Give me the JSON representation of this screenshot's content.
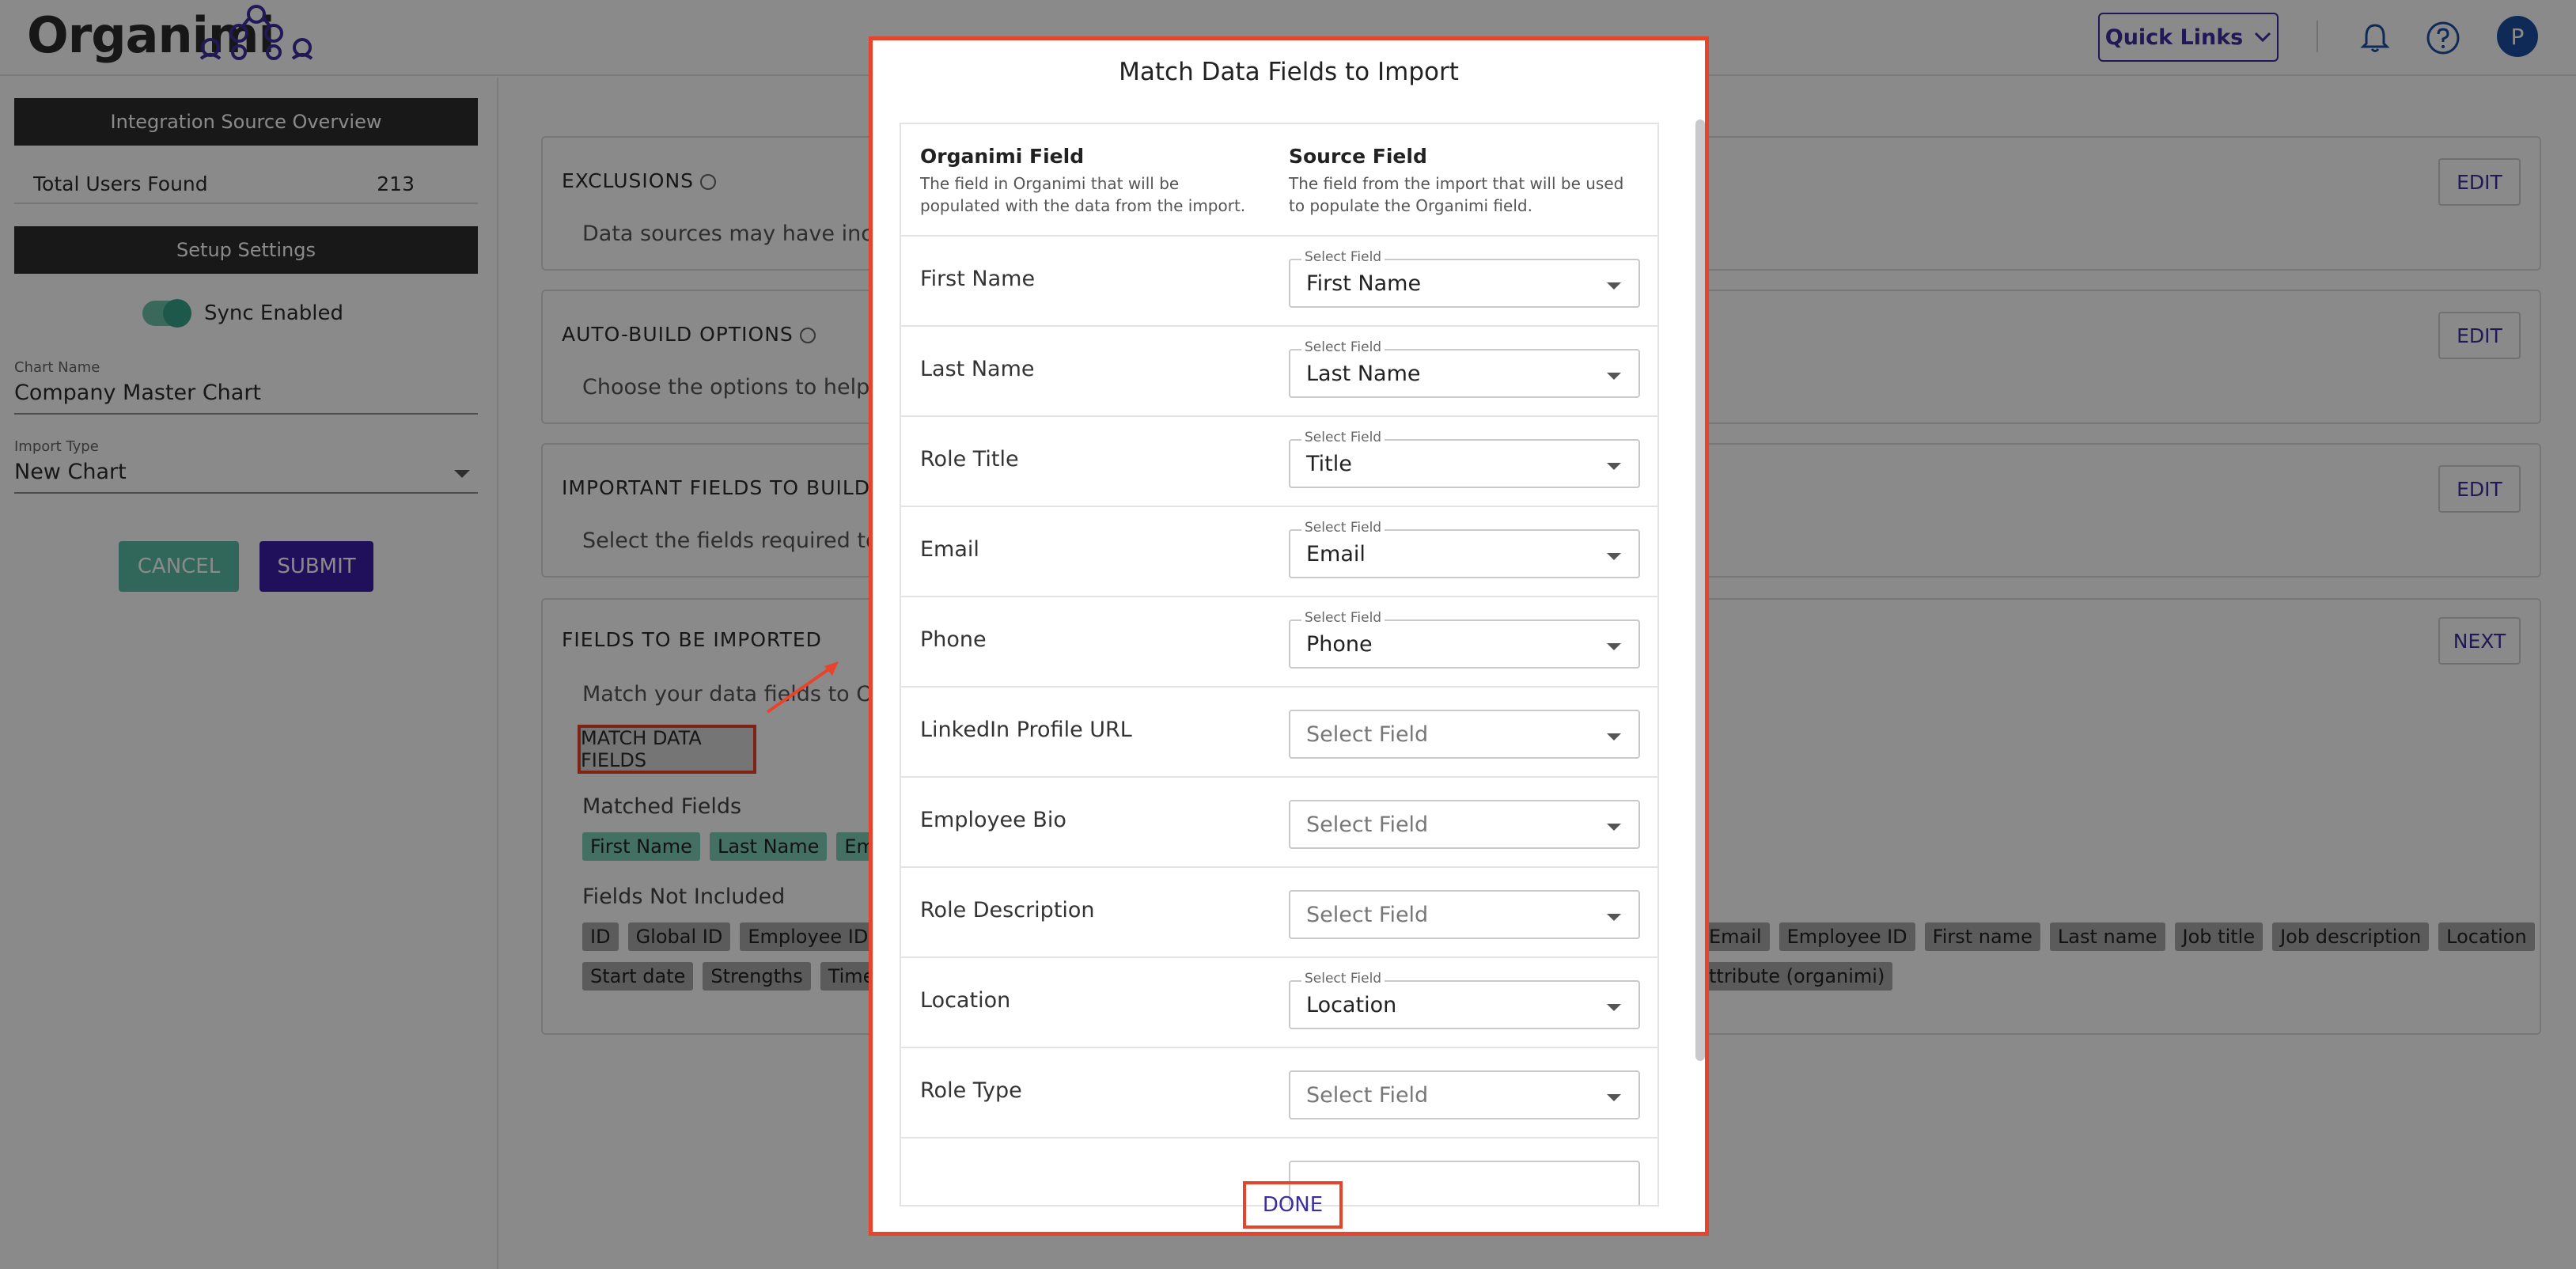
{
  "app": {
    "logo": "Organimi"
  },
  "header": {
    "quick_links": "Quick Links",
    "avatar_initial": "P"
  },
  "left": {
    "overview_title": "Integration Source Overview",
    "total_users_label": "Total Users Found",
    "total_users_value": "213",
    "setup_title": "Setup Settings",
    "sync_label": "Sync Enabled",
    "chart_name_label": "Chart Name",
    "chart_name_value": "Company Master Chart",
    "import_type_label": "Import Type",
    "import_type_value": "New Chart",
    "cancel": "CANCEL",
    "submit": "SUBMIT"
  },
  "cards": {
    "exclusions": {
      "title": "EXCLUSIONS",
      "desc": "Data sources may have incom",
      "btn": "EDIT"
    },
    "auto_build": {
      "title": "AUTO-BUILD OPTIONS",
      "desc": "Choose the options to help cu",
      "btn": "EDIT"
    },
    "important": {
      "title": "IMPORTANT FIELDS TO BUILD CHA",
      "desc": "Select the fields required to bu",
      "btn": "EDIT"
    },
    "fields": {
      "title": "FIELDS TO BE IMPORTED",
      "desc": "Match your data fields to Orga",
      "btn": "NEXT",
      "match_btn": "MATCH DATA FIELDS",
      "matched_label": "Matched Fields",
      "matched": [
        "First Name",
        "Last Name",
        "Ema"
      ],
      "not_included_label": "Fields Not Included",
      "not_included_row1_left": [
        "ID",
        "Global ID",
        "Employee ID"
      ],
      "not_included_row1_right": [
        "Email",
        "Employee ID",
        "First name",
        "Last name",
        "Job title",
        "Job description",
        "Location"
      ],
      "not_included_row2_left": [
        "Start date",
        "Strengths",
        "Timez"
      ],
      "not_included_row2_right": [
        "ttribute (organimi)"
      ]
    }
  },
  "modal": {
    "title": "Match Data Fields to Import",
    "col1_title": "Organimi Field",
    "col1_desc": "The field in Organimi that will be populated with the data from the import.",
    "col2_title": "Source Field",
    "col2_desc": "The field from the import that will be used to populate the Organimi field.",
    "select_label": "Select Field",
    "rows": [
      {
        "field": "First Name",
        "value": "First Name",
        "selected": true
      },
      {
        "field": "Last Name",
        "value": "Last Name",
        "selected": true
      },
      {
        "field": "Role Title",
        "value": "Title",
        "selected": true
      },
      {
        "field": "Email",
        "value": "Email",
        "selected": true
      },
      {
        "field": "Phone",
        "value": "Phone",
        "selected": true
      },
      {
        "field": "LinkedIn Profile URL",
        "value": "Select Field",
        "selected": false
      },
      {
        "field": "Employee Bio",
        "value": "Select Field",
        "selected": false
      },
      {
        "field": "Role Description",
        "value": "Select Field",
        "selected": false
      },
      {
        "field": "Location",
        "value": "Location",
        "selected": true
      },
      {
        "field": "Role Type",
        "value": "Select Field",
        "selected": false
      }
    ],
    "done": "DONE"
  },
  "colors": {
    "accent": "#3b2fa0",
    "highlight": "#e8442c",
    "matched_chip": "#7ccfb8",
    "toggle": "#37a58a"
  }
}
